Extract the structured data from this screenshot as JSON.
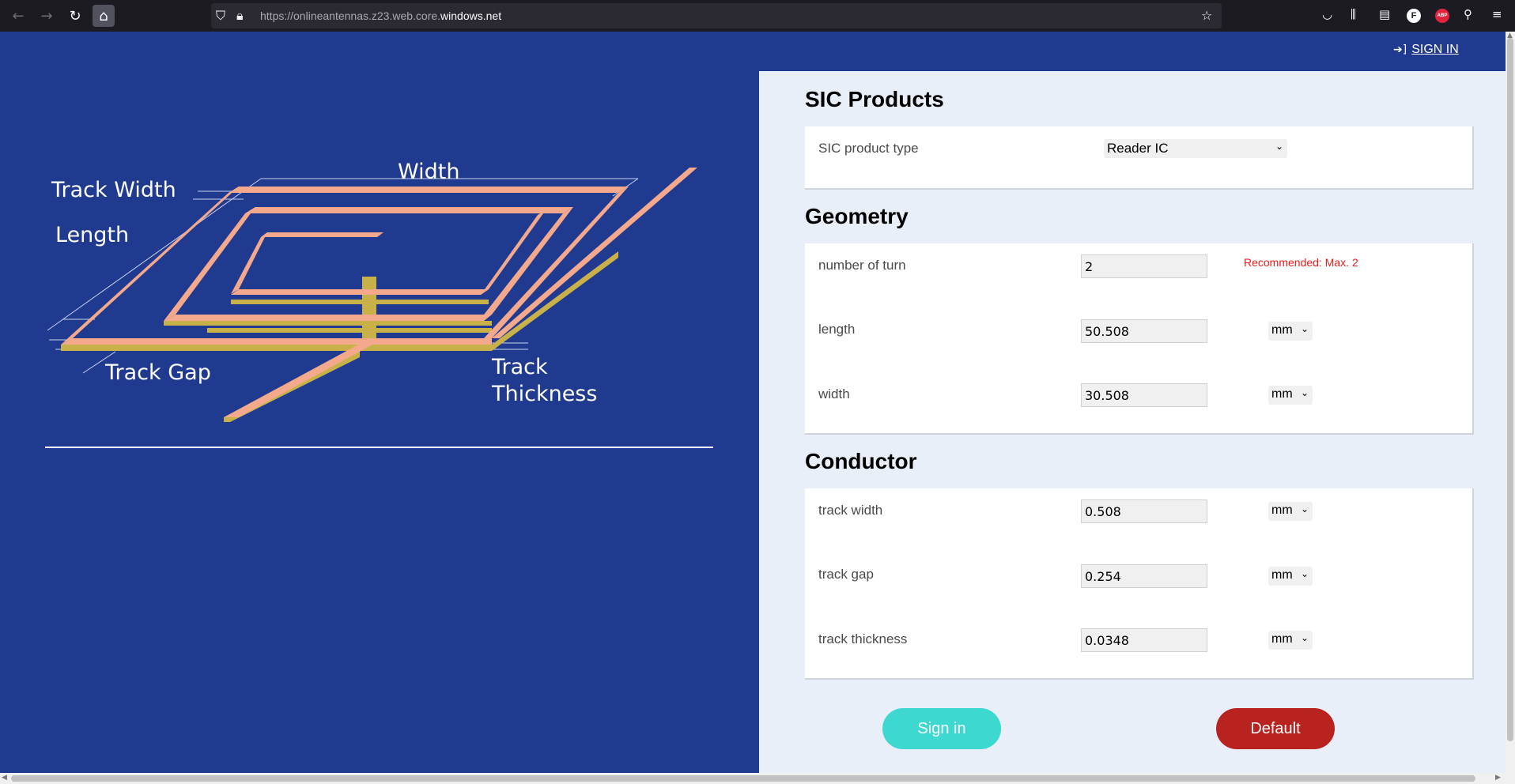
{
  "browser": {
    "url_host_dim": "https://onlineantennas.z23.web.core.",
    "url_host_main": "windows.net",
    "icons": {
      "back": "arrow-left-icon",
      "forward": "arrow-right-icon",
      "reload": "reload-icon",
      "home": "home-icon",
      "shield": "shield-icon",
      "lock": "lock-icon",
      "bookmark": "star-icon",
      "pocket": "pocket-icon",
      "library": "library-icon",
      "reader": "reader-view-icon",
      "profile": "profile-icon",
      "adblock": "abp-icon",
      "extensions": "extensions-icon",
      "menu": "hamburger-menu-icon"
    },
    "profile_initial": "F",
    "abp_text": "ABP"
  },
  "header": {
    "signin_label": "SIGN IN",
    "signin_icon": "sign-in-icon"
  },
  "diagram": {
    "labels": {
      "track_width": "Track Width",
      "width": "Width",
      "length": "Length",
      "track_gap": "Track Gap",
      "track": "Track",
      "thickness": "Thickness"
    },
    "colors": {
      "copper_top": "#f4a98c",
      "copper_side": "#c9b14a",
      "background": "#1f3a8f"
    }
  },
  "form": {
    "sic": {
      "title": "SIC Products",
      "product_type_label": "SIC product type",
      "product_type_value": "Reader IC"
    },
    "geometry": {
      "title": "Geometry",
      "turns_label": "number of turn",
      "turns_value": "2",
      "turns_hint": "Recommended: Max. 2",
      "length_label": "length",
      "length_value": "50.508",
      "length_unit": "mm",
      "width_label": "width",
      "width_value": "30.508",
      "width_unit": "mm"
    },
    "conductor": {
      "title": "Conductor",
      "track_width_label": "track width",
      "track_width_value": "0.508",
      "track_width_unit": "mm",
      "track_gap_label": "track gap",
      "track_gap_value": "0.254",
      "track_gap_unit": "mm",
      "track_thickness_label": "track thickness",
      "track_thickness_value": "0.0348",
      "track_thickness_unit": "mm"
    },
    "buttons": {
      "signin": "Sign in",
      "default": "Default"
    },
    "colors": {
      "signin_button": "#3dd9d1",
      "default_button": "#b8221f",
      "hint": "#e81b1b"
    }
  }
}
